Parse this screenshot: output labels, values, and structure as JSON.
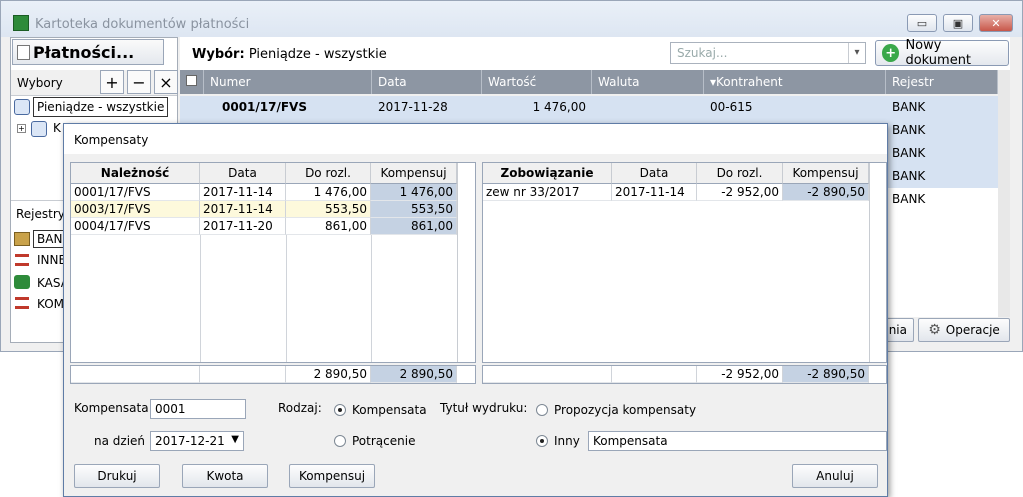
{
  "window": {
    "title": "Kartoteka dokumentów płatności",
    "minimize": "▭",
    "maximize": "▣",
    "close": "✕"
  },
  "left": {
    "module_title": "Płatności...",
    "wybory_label": "Wybory",
    "add": "+",
    "remove": "−",
    "delete": "×",
    "tree": [
      {
        "label": "Pieniądze - wszystkie"
      },
      {
        "label": "K"
      }
    ],
    "rejestry_label": "Rejestry",
    "registers": [
      {
        "label": "BAN",
        "color": "#3a6fc4"
      },
      {
        "label": "INNE",
        "color": "#c0392b"
      },
      {
        "label": "KASA",
        "color": "#2e8b3a"
      },
      {
        "label": "KOM",
        "color": "#c0392b"
      }
    ]
  },
  "grid": {
    "wybor_label": "Wybór:",
    "wybor_value": "Pieniądze - wszystkie",
    "search_placeholder": "Szukaj...",
    "new_doc": "Nowy dokument",
    "columns": [
      "Numer",
      "Data",
      "Wartość",
      "Waluta",
      "▾Kontrahent",
      "Rejestr"
    ],
    "rows": [
      {
        "numer": "0001/17/FVS",
        "data": "2017-11-28",
        "wartosc": "1 476,00",
        "waluta": "",
        "kontrahent": "00-615",
        "rejestr": "BANK"
      },
      {
        "numer": "",
        "data": "",
        "wartosc": "",
        "waluta": "",
        "kontrahent": "",
        "rejestr": "BANK"
      },
      {
        "numer": "",
        "data": "",
        "wartosc": "",
        "waluta": "",
        "kontrahent": "",
        "rejestr": "BANK"
      },
      {
        "numer": "",
        "data": "",
        "wartosc": "",
        "waluta": "",
        "kontrahent": "",
        "rejestr": "BANK"
      },
      {
        "numer": "",
        "data": "",
        "wartosc": "",
        "waluta": "",
        "kontrahent": "",
        "rejestr": "BANK"
      }
    ],
    "footer_partial": "nia",
    "operacje": "Operacje"
  },
  "dialog": {
    "title": "Kompensaty",
    "left_table": {
      "headers": [
        "Należność",
        "Data",
        "Do rozl.",
        "Kompensuj"
      ],
      "rows": [
        [
          "0001/17/FVS",
          "2017-11-14",
          "1 476,00",
          "1 476,00"
        ],
        [
          "0003/17/FVS",
          "2017-11-14",
          "553,50",
          "553,50"
        ],
        [
          "0004/17/FVS",
          "2017-11-20",
          "861,00",
          "861,00"
        ]
      ],
      "totals": [
        "",
        "",
        "2 890,50",
        "2 890,50"
      ]
    },
    "right_table": {
      "headers": [
        "Zobowiązanie",
        "Data",
        "Do rozl.",
        "Kompensuj"
      ],
      "rows": [
        [
          "zew nr 33/2017",
          "2017-11-14",
          "-2 952,00",
          "-2 890,50"
        ]
      ],
      "totals": [
        "",
        "",
        "-2 952,00",
        "-2 890,50"
      ]
    },
    "kompensata_label": "Kompensata",
    "kompensata_value": "0001",
    "na_dzien_label": "na dzień",
    "na_dzien_value": "2017-12-21",
    "rodzaj_label": "Rodzaj:",
    "rodzaj_kompensata": "Kompensata",
    "rodzaj_potracenie": "Potrącenie",
    "tytul_label": "Tytuł wydruku:",
    "tytul_propozycja": "Propozycja kompensaty",
    "tytul_inny": "Inny",
    "tytul_value": "Kompensata",
    "buttons": {
      "drukuj": "Drukuj",
      "kwota": "Kwota",
      "kompensuj": "Kompensuj",
      "anuluj": "Anuluj"
    }
  }
}
